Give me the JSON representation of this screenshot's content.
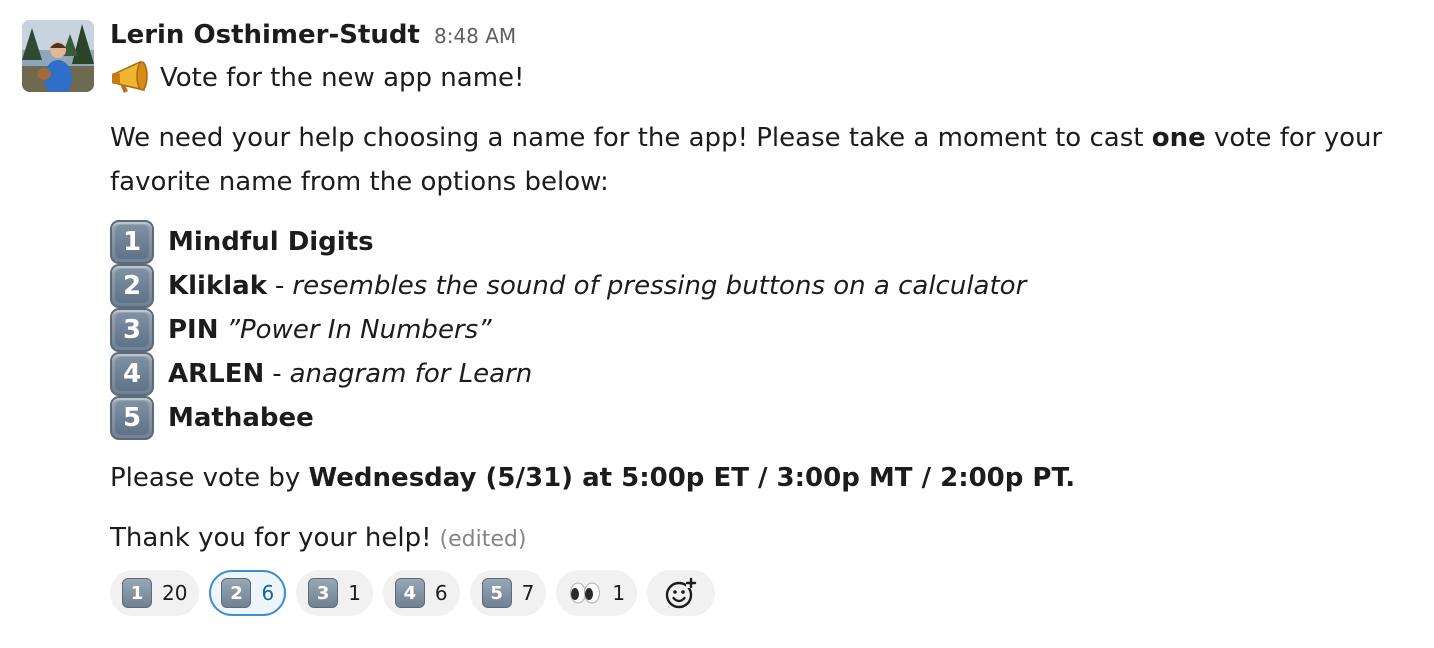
{
  "message": {
    "sender": "Lerin Osthimer-Studt",
    "timestamp": "8:48 AM",
    "title": "Vote for the new app name!",
    "intro_before": "We need your help choosing a name for the app! Please take a moment to cast ",
    "intro_bold": "one",
    "intro_after": " vote for your",
    "intro_line2": "favorite name from the options below:",
    "options": [
      {
        "num": "1",
        "name": "Mindful Digits",
        "sep": "",
        "desc": ""
      },
      {
        "num": "2",
        "name": "Kliklak",
        "sep": "-",
        "desc": "resembles the sound of pressing buttons on a calculator"
      },
      {
        "num": "3",
        "name": "PIN",
        "sep": "",
        "desc": "”Power In Numbers”"
      },
      {
        "num": "4",
        "name": "ARLEN",
        "sep": "-",
        "desc": "anagram for Learn"
      },
      {
        "num": "5",
        "name": "Mathabee",
        "sep": "",
        "desc": ""
      }
    ],
    "deadline_prefix": "Please vote by ",
    "deadline_bold": "Wednesday (5/31) at 5:00p ET / 3:00p MT / 2:00p PT.",
    "thanks": "Thank you for your help!",
    "edited": "(edited)"
  },
  "reactions": [
    {
      "emoji": "keycap-1",
      "label": "1",
      "count": "20",
      "selected": false
    },
    {
      "emoji": "keycap-2",
      "label": "2",
      "count": "6",
      "selected": true
    },
    {
      "emoji": "keycap-3",
      "label": "3",
      "count": "1",
      "selected": false
    },
    {
      "emoji": "keycap-4",
      "label": "4",
      "count": "6",
      "selected": false
    },
    {
      "emoji": "keycap-5",
      "label": "5",
      "count": "7",
      "selected": false
    },
    {
      "emoji": "eyes",
      "label": "",
      "count": "1",
      "selected": false
    }
  ],
  "icons": {
    "title_emoji": "megaphone-icon",
    "add_reaction": "add-reaction-icon"
  },
  "colors": {
    "selected_border": "#3d8fd2",
    "selected_count": "#1264a3",
    "timestamp": "#616061"
  }
}
